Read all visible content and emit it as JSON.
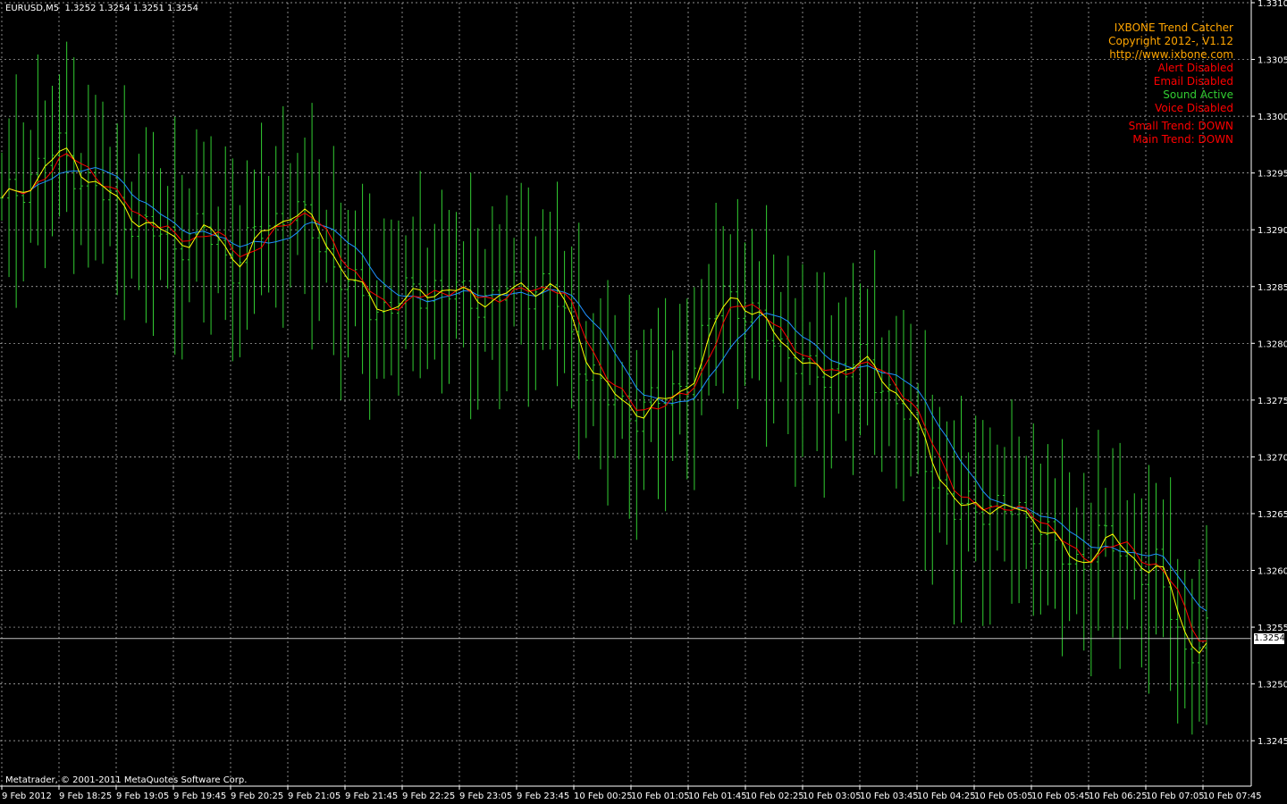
{
  "header": {
    "symbol": "EURUSD,M5",
    "ohlc": "1.3252 1.3254 1.3251 1.3254"
  },
  "indicator": {
    "title": "IXBONE Trend Catcher",
    "copyright": "Copyright 2012-, V1.12",
    "url": "http://www.ixbone.com",
    "alert": "Alert Disabled",
    "email": "Email Disabled",
    "sound": "Sound Active",
    "voice": "Voice Disabled",
    "small_trend": "Small Trend: DOWN",
    "main_trend": "Main Trend: DOWN"
  },
  "footer": {
    "copyright": "Metatrader, © 2001-2011 MetaQuotes Software Corp."
  },
  "colors": {
    "background": "#000000",
    "grid": "#c0c0c0",
    "bars": "#32cd32",
    "ma_fast": "#ffff00",
    "ma_mid": "#ff0000",
    "ma_slow": "#1e90ff",
    "title_color": "#ffa500",
    "alert_color": "#ff0000",
    "sound_color": "#32cd32"
  },
  "chart_data": {
    "type": "ohlc",
    "ylim": [
      1.3241,
      1.331
    ],
    "ytick_labels": [
      "1.3310",
      "1.3305",
      "1.3300",
      "1.3295",
      "1.3290",
      "1.3285",
      "1.3280",
      "1.3275",
      "1.3270",
      "1.3265",
      "1.3260",
      "1.3255",
      "1.3250",
      "1.3245"
    ],
    "ytick_values": [
      1.331,
      1.3305,
      1.33,
      1.3295,
      1.329,
      1.3285,
      1.328,
      1.3275,
      1.327,
      1.3265,
      1.326,
      1.3255,
      1.325,
      1.3245
    ],
    "xtick_labels": [
      "9 Feb 2012",
      "9 Feb 18:25",
      "9 Feb 19:05",
      "9 Feb 19:45",
      "9 Feb 20:25",
      "9 Feb 21:05",
      "9 Feb 21:45",
      "9 Feb 22:25",
      "9 Feb 23:05",
      "9 Feb 23:45",
      "10 Feb 00:25",
      "10 Feb 01:05",
      "10 Feb 01:45",
      "10 Feb 02:25",
      "10 Feb 03:05",
      "10 Feb 03:45",
      "10 Feb 04:25",
      "10 Feb 05:05",
      "10 Feb 05:45",
      "10 Feb 06:25",
      "10 Feb 07:05",
      "10 Feb 07:45"
    ],
    "bar_count": 168,
    "current_price": "1.3254",
    "current_price_value": 1.3254,
    "key_closes": [
      [
        0,
        1.3292
      ],
      [
        4,
        1.3295
      ],
      [
        8,
        1.3297
      ],
      [
        12,
        1.3294
      ],
      [
        16,
        1.3292
      ],
      [
        20,
        1.329
      ],
      [
        24,
        1.3289
      ],
      [
        28,
        1.329
      ],
      [
        32,
        1.3287
      ],
      [
        36,
        1.329
      ],
      [
        40,
        1.3292
      ],
      [
        44,
        1.3289
      ],
      [
        48,
        1.3285
      ],
      [
        52,
        1.3283
      ],
      [
        56,
        1.3284
      ],
      [
        60,
        1.3285
      ],
      [
        64,
        1.3284
      ],
      [
        68,
        1.3284
      ],
      [
        72,
        1.3285
      ],
      [
        76,
        1.3285
      ],
      [
        80,
        1.3279
      ],
      [
        84,
        1.3275
      ],
      [
        88,
        1.3274
      ],
      [
        92,
        1.3275
      ],
      [
        96,
        1.3278
      ],
      [
        100,
        1.3285
      ],
      [
        104,
        1.3282
      ],
      [
        108,
        1.328
      ],
      [
        112,
        1.3277
      ],
      [
        116,
        1.3278
      ],
      [
        120,
        1.3278
      ],
      [
        124,
        1.3275
      ],
      [
        128,
        1.327
      ],
      [
        132,
        1.3265
      ],
      [
        136,
        1.3266
      ],
      [
        140,
        1.3265
      ],
      [
        144,
        1.3264
      ],
      [
        148,
        1.326
      ],
      [
        152,
        1.3263
      ],
      [
        156,
        1.3261
      ],
      [
        160,
        1.326
      ],
      [
        164,
        1.3253
      ],
      [
        167,
        1.3254
      ]
    ]
  }
}
